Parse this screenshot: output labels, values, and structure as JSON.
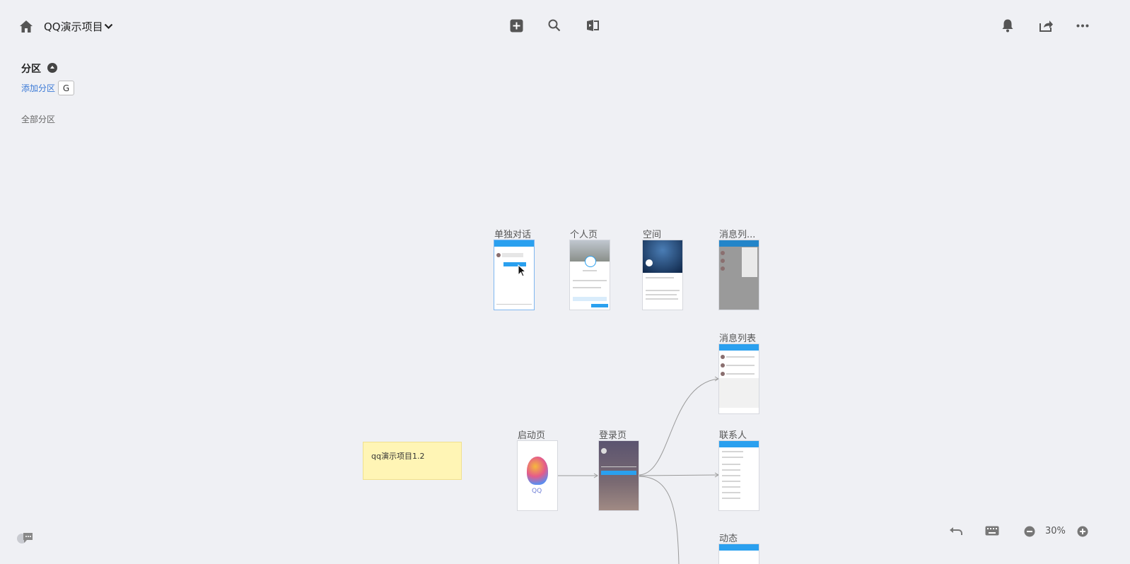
{
  "header": {
    "project_title": "QQ演示项目"
  },
  "sidebar": {
    "section_title": "分区",
    "add_section_label": "添加分区",
    "add_section_shortcut": "G",
    "all_sections_label": "全部分区"
  },
  "canvas": {
    "screens": [
      {
        "label": "单独对话"
      },
      {
        "label": "个人页"
      },
      {
        "label": "空间"
      },
      {
        "label": "消息列..."
      },
      {
        "label": "消息列表"
      },
      {
        "label": "启动页"
      },
      {
        "label": "登录页"
      },
      {
        "label": "联系人"
      },
      {
        "label": "动态"
      }
    ],
    "sticky_note": "qq演示项目1.2"
  },
  "footer": {
    "zoom": "30%"
  },
  "colors": {
    "background": "#eff0f4",
    "accent": "#3a79d6",
    "note": "#fff5b5",
    "app_blue": "#2aa0ef"
  }
}
